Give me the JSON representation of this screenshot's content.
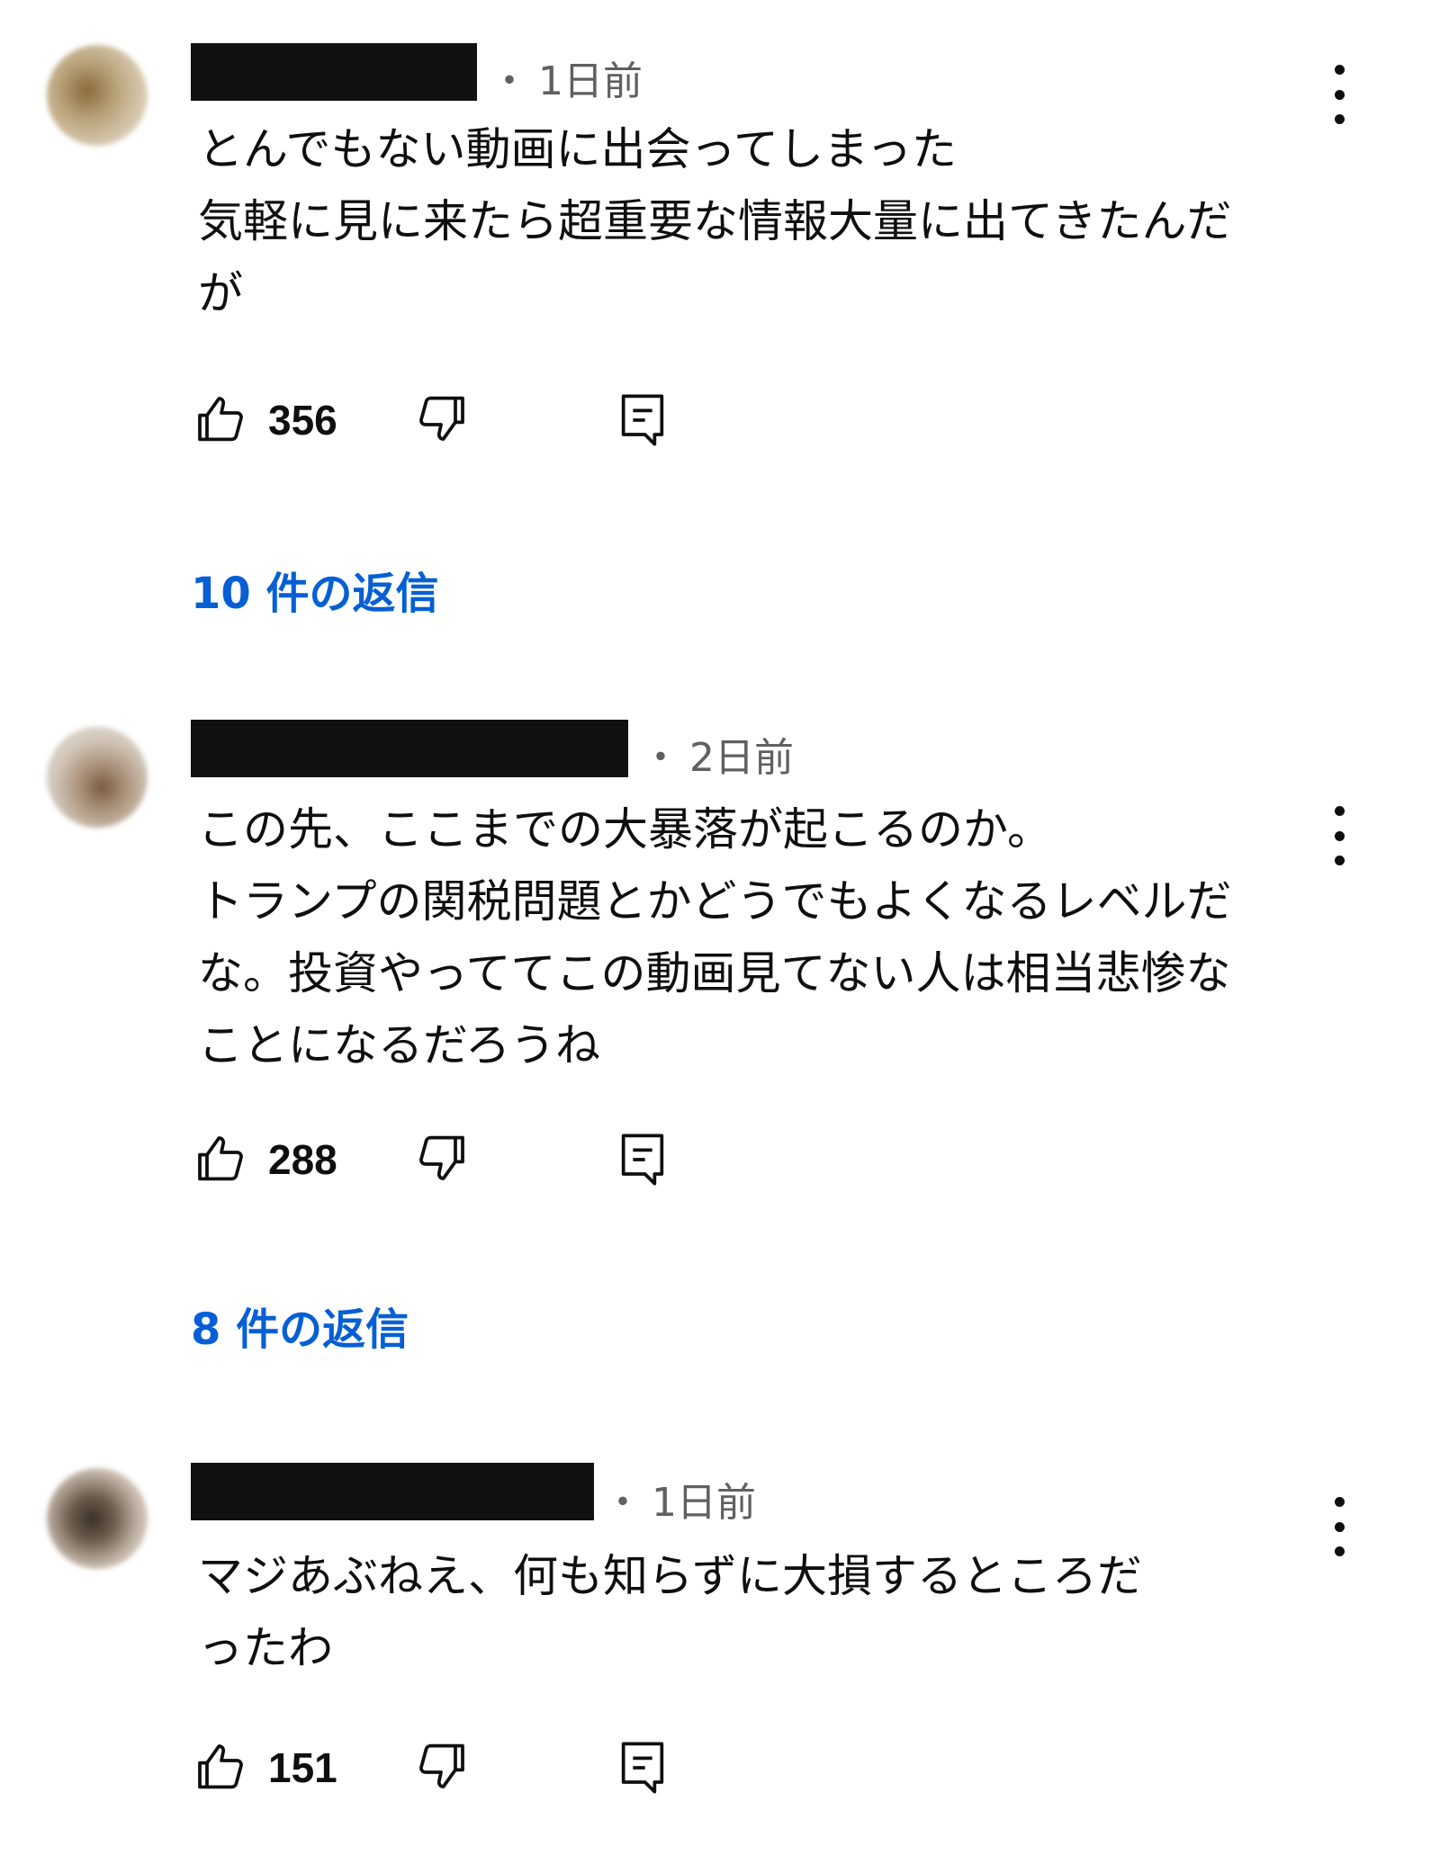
{
  "comments": [
    {
      "time": "1日前",
      "lines": [
        "とんでもない動画に出会ってしまった",
        "気軽に見に来たら超重要な情報大量に出てきたんだ",
        "が"
      ],
      "likes": "356",
      "replies": "10 件の返信",
      "avatar_color": "#c9b79a"
    },
    {
      "time": "2日前",
      "lines": [
        "この先、ここまでの大暴落が起こるのか。",
        "トランプの関税問題とかどうでもよくなるレベルだ",
        "な。投資やっててこの動画見てない人は相当悲惨な",
        "ことになるだろうね"
      ],
      "likes": "288",
      "replies": "8 件の返信",
      "avatar_color": "#d8cfc2"
    },
    {
      "time": "1日前",
      "lines": [
        "マジあぶねえ、何も知らずに大損するところだ",
        "ったわ"
      ],
      "likes": "151",
      "avatar_color": "#cdbfae"
    }
  ],
  "separator": "・",
  "icons": {
    "like": "thumbs-up-icon",
    "dislike": "thumbs-down-icon",
    "reply": "comment-reply-icon",
    "more": "more-vert-icon"
  },
  "colors": {
    "link": "#065fd4",
    "meta": "#606060",
    "text": "#0f0f0f"
  }
}
